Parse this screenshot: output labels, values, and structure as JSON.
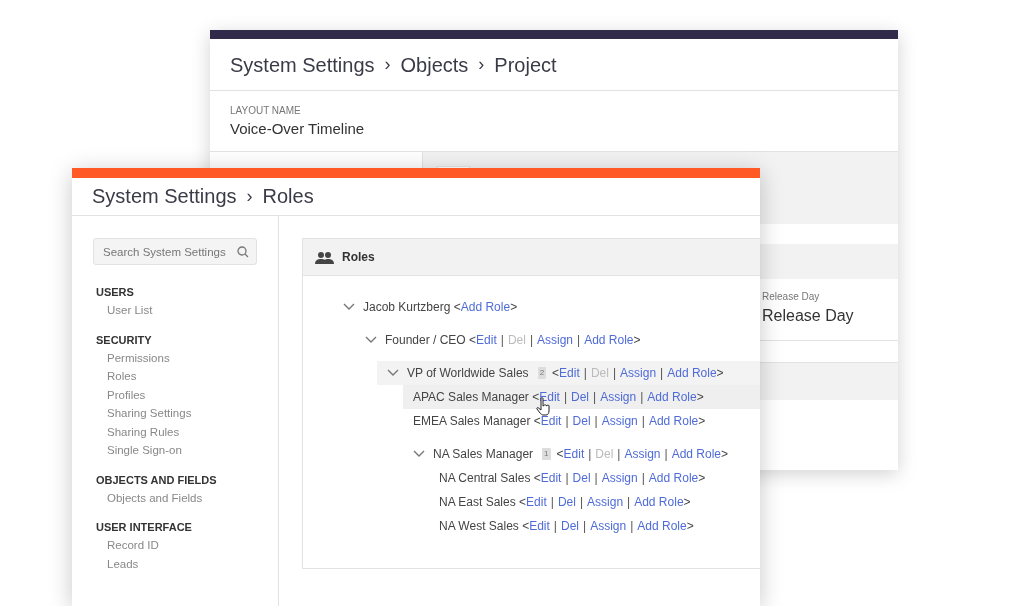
{
  "back_window": {
    "breadcrumb": [
      {
        "label": "System Settings"
      },
      {
        "separator": "›",
        "label": "Objects"
      },
      {
        "separator": "›",
        "label": "Project"
      }
    ],
    "layout_name": {
      "label": "LAYOUT NAME",
      "value": "Voice-Over Timeline"
    },
    "release_field": {
      "label": "Release Day",
      "value": "Release Day"
    }
  },
  "front_window": {
    "breadcrumb": [
      {
        "label": "System Settings"
      },
      {
        "separator": "›",
        "label": "Roles"
      }
    ],
    "search": {
      "placeholder": "Search System Settings"
    },
    "sidebar": [
      {
        "heading": "USERS",
        "items": [
          {
            "label": "User List"
          }
        ]
      },
      {
        "heading": "SECURITY",
        "items": [
          {
            "label": "Permissions"
          },
          {
            "label": "Roles"
          },
          {
            "label": "Profiles"
          },
          {
            "label": "Sharing Settings"
          },
          {
            "label": "Sharing Rules"
          },
          {
            "label": "Single Sign-on"
          }
        ]
      },
      {
        "heading": "OBJECTS AND FIELDS",
        "items": [
          {
            "label": "Objects and Fields"
          }
        ]
      },
      {
        "heading": "USER INTERFACE",
        "items": [
          {
            "label": "Record ID"
          },
          {
            "label": "Leads"
          }
        ]
      }
    ],
    "panel": {
      "title": "Roles",
      "tree": [
        {
          "name": "Jacob Kurtzberg",
          "expanded": true,
          "selected": false,
          "hovered": false,
          "open": "<",
          "close": ">",
          "actions": [
            {
              "label": "Add Role",
              "disabled": false
            }
          ],
          "children": [
            {
              "name": "Founder / CEO",
              "expanded": true,
              "selected": false,
              "hovered": false,
              "open": "<",
              "close": ">",
              "actions": [
                {
                  "label": "Edit",
                  "disabled": false
                },
                {
                  "separator": "|",
                  "label": "Del",
                  "disabled": true
                },
                {
                  "separator": "|",
                  "label": "Assign",
                  "disabled": false
                },
                {
                  "separator": "|",
                  "label": "Add Role",
                  "disabled": false
                }
              ],
              "children": [
                {
                  "name": "VP of Worldwide Sales",
                  "expanded": true,
                  "badge": "2",
                  "selected": true,
                  "hovered": false,
                  "open": "<",
                  "close": ">",
                  "actions": [
                    {
                      "label": "Edit",
                      "disabled": false
                    },
                    {
                      "separator": "|",
                      "label": "Del",
                      "disabled": true
                    },
                    {
                      "separator": "|",
                      "label": "Assign",
                      "disabled": false
                    },
                    {
                      "separator": "|",
                      "label": "Add Role",
                      "disabled": false
                    }
                  ],
                  "children": [
                    {
                      "name": "APAC Sales Manager",
                      "selected": false,
                      "hovered": true,
                      "open": "<",
                      "close": ">",
                      "actions": [
                        {
                          "label": "Edit",
                          "disabled": false
                        },
                        {
                          "separator": "|",
                          "label": "Del",
                          "disabled": false
                        },
                        {
                          "separator": "|",
                          "label": "Assign",
                          "disabled": false
                        },
                        {
                          "separator": "|",
                          "label": "Add Role",
                          "disabled": false
                        }
                      ]
                    },
                    {
                      "name": "EMEA Sales Manager",
                      "selected": false,
                      "hovered": false,
                      "open": "<",
                      "close": ">",
                      "actions": [
                        {
                          "label": "Edit",
                          "disabled": false
                        },
                        {
                          "separator": "|",
                          "label": "Del",
                          "disabled": false
                        },
                        {
                          "separator": "|",
                          "label": "Assign",
                          "disabled": false
                        },
                        {
                          "separator": "|",
                          "label": "Add Role",
                          "disabled": false
                        }
                      ]
                    },
                    {
                      "name": "NA Sales Manager",
                      "expanded": true,
                      "badge": "1",
                      "selected": false,
                      "hovered": false,
                      "open": "<",
                      "close": ">",
                      "actions": [
                        {
                          "label": "Edit",
                          "disabled": false
                        },
                        {
                          "separator": "|",
                          "label": "Del",
                          "disabled": true
                        },
                        {
                          "separator": "|",
                          "label": "Assign",
                          "disabled": false
                        },
                        {
                          "separator": "|",
                          "label": "Add Role",
                          "disabled": false
                        }
                      ],
                      "children": [
                        {
                          "name": "NA Central Sales",
                          "selected": false,
                          "hovered": false,
                          "open": "<",
                          "close": ">",
                          "actions": [
                            {
                              "label": "Edit",
                              "disabled": false
                            },
                            {
                              "separator": "|",
                              "label": "Del",
                              "disabled": false
                            },
                            {
                              "separator": "|",
                              "label": "Assign",
                              "disabled": false
                            },
                            {
                              "separator": "|",
                              "label": "Add Role",
                              "disabled": false
                            }
                          ]
                        },
                        {
                          "name": "NA East Sales",
                          "selected": false,
                          "hovered": false,
                          "open": "<",
                          "close": ">",
                          "actions": [
                            {
                              "label": "Edit",
                              "disabled": false
                            },
                            {
                              "separator": "|",
                              "label": "Del",
                              "disabled": false
                            },
                            {
                              "separator": "|",
                              "label": "Assign",
                              "disabled": false
                            },
                            {
                              "separator": "|",
                              "label": "Add Role",
                              "disabled": false
                            }
                          ]
                        },
                        {
                          "name": "NA West Sales",
                          "selected": false,
                          "hovered": false,
                          "open": "<",
                          "close": ">",
                          "actions": [
                            {
                              "label": "Edit",
                              "disabled": false
                            },
                            {
                              "separator": "|",
                              "label": "Del",
                              "disabled": false
                            },
                            {
                              "separator": "|",
                              "label": "Assign",
                              "disabled": false
                            },
                            {
                              "separator": "|",
                              "label": "Add Role",
                              "disabled": false
                            }
                          ]
                        }
                      ]
                    }
                  ]
                }
              ]
            }
          ]
        }
      ]
    }
  }
}
